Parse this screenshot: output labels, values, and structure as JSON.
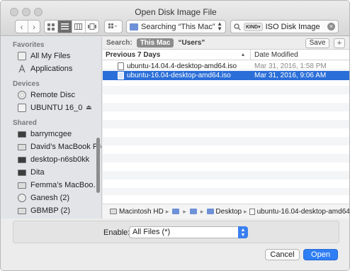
{
  "window": {
    "title": "Open Disk Image File"
  },
  "toolbar": {
    "back_icon": "chevron-left",
    "forward_icon": "chevron-right",
    "view_modes": [
      "icon-view",
      "list-view",
      "column-view",
      "cover-flow-view"
    ],
    "active_view": "list-view",
    "arrange_icon": "grid-arrange",
    "location": "Searching “This Mac”",
    "search_kind": "KIND▾",
    "search_query": "ISO Disk Image"
  },
  "sidebar": {
    "favorites_header": "Favorites",
    "favorites": [
      {
        "label": "All My Files",
        "icon": "all-files"
      },
      {
        "label": "Applications",
        "icon": "applications"
      }
    ],
    "devices_header": "Devices",
    "devices": [
      {
        "label": "Remote Disc",
        "icon": "disc"
      },
      {
        "label": "UBUNTU 16_0",
        "icon": "drive",
        "eject": "⏏"
      }
    ],
    "shared_header": "Shared",
    "shared": [
      {
        "label": "barrymcgee",
        "icon": "computer"
      },
      {
        "label": "David’s MacBook Pro",
        "icon": "laptop"
      },
      {
        "label": "desktop-n6sb0kk",
        "icon": "computer"
      },
      {
        "label": "Dita",
        "icon": "computer"
      },
      {
        "label": "Femma’s MacBoo…",
        "icon": "laptop"
      },
      {
        "label": "Ganesh (2)",
        "icon": "globe"
      },
      {
        "label": "GBMBP (2)",
        "icon": "laptop"
      }
    ]
  },
  "scopebar": {
    "label": "Search:",
    "this_mac": "This Mac",
    "users": "“Users”",
    "save": "Save",
    "add": "+"
  },
  "columns": {
    "name": "Previous 7 Days",
    "sort_indicator": "▴",
    "date": "Date Modified"
  },
  "files": [
    {
      "name": "ubuntu-14.04.4-desktop-amd64.iso",
      "date": "Mar 31, 2016, 1:58 PM",
      "selected": false
    },
    {
      "name": "ubuntu-16.04-desktop-amd64.iso",
      "date": "Mar 31, 2016, 9:06 AM",
      "selected": true
    }
  ],
  "pathbar": {
    "drive": "Macintosh HD",
    "sep": "▸",
    "f1": "U",
    "f2": "p",
    "desktop": "Desktop",
    "file": "ubuntu-16.04-desktop-amd64.iso"
  },
  "bottom": {
    "enable_label": "Enable:",
    "enable_value": "All Files (*)",
    "cancel": "Cancel",
    "open": "Open"
  },
  "colors": {
    "selection": "#2a6ed8",
    "accent_button": "#2f7ef5"
  }
}
